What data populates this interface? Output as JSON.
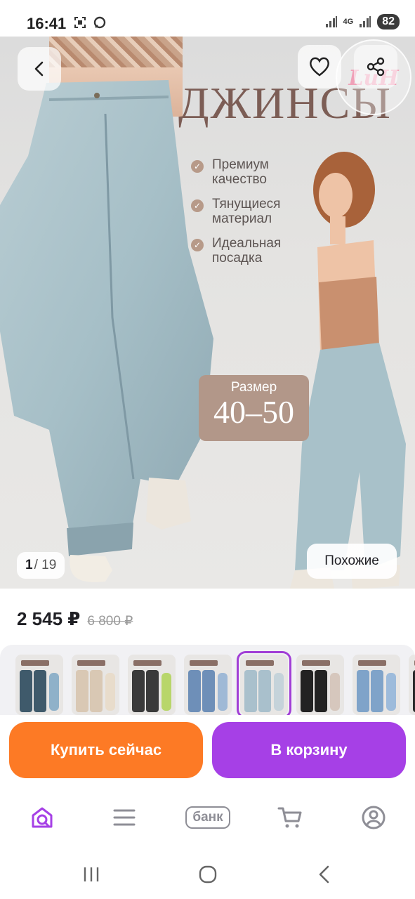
{
  "status_bar": {
    "time": "16:41",
    "network": "4G",
    "battery": "82"
  },
  "hero": {
    "heading": "ДЖИНСЫ",
    "shop_logo_text": "LuH",
    "features": [
      "Премиум качество",
      "Тянущиеся материал",
      "Идеальная посадка"
    ],
    "size_label": "Размер",
    "size_value": "40–50",
    "counter_current": "1",
    "counter_total": "/ 19",
    "similar_label": "Похожие",
    "icons": {
      "back": "chevron-left-icon",
      "favorite": "heart-icon",
      "share": "share-icon"
    }
  },
  "price": {
    "current": "2 545 ₽",
    "old": "6 800 ₽"
  },
  "thumbnails": [
    {
      "color": "#3f5a6b",
      "fig": "#8fb1c9",
      "selected": false
    },
    {
      "color": "#d9c8b4",
      "fig": "#e8dccb",
      "selected": false
    },
    {
      "color": "#3a3a3a",
      "fig": "#b8d66a",
      "selected": false
    },
    {
      "color": "#6e8fb8",
      "fig": "#9fb9d6",
      "selected": false
    },
    {
      "color": "#a9c0cc",
      "fig": "#c5d3da",
      "selected": true
    },
    {
      "color": "#222222",
      "fig": "#d6c7bd",
      "selected": false
    },
    {
      "color": "#7fa3c9",
      "fig": "#9dbbdb",
      "selected": false
    },
    {
      "color": "#2a2a2a",
      "fig": "#bcbcbc",
      "selected": false
    }
  ],
  "actions": {
    "buy_now": "Купить сейчас",
    "add_to_cart": "В корзину",
    "colors": {
      "buy_now": "#fd7a25",
      "add_to_cart": "#a640e6"
    }
  },
  "bottom_nav": {
    "bank_label": "банк",
    "items": [
      "home-search-icon",
      "menu-icon",
      "bank-icon",
      "cart-icon",
      "profile-icon"
    ],
    "accent": "#a640e6"
  }
}
